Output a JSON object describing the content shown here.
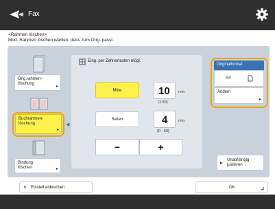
{
  "header": {
    "title": "Fax"
  },
  "message": {
    "line1": "<Rahmen löschen>",
    "line2": "Mod. Rahmen löschen wählen, dass zum Orig. passt."
  },
  "left": {
    "orig_frame": "Orig.rahmen-\nlöschung",
    "book_frame": "Buchrahmen-\nlöschung",
    "binding": "Bindung\nlöschen"
  },
  "center": {
    "note": "Eing. per Zehnertasten mögl.",
    "center_label": "Mitte",
    "center_value": "10",
    "center_unit": "mm",
    "center_range": "(1-50)",
    "side_label": "Seiten",
    "side_value": "4",
    "side_unit": "mm",
    "side_range": "(0 - 50)",
    "minus": "−",
    "plus": "+"
  },
  "right": {
    "format_header": "Originalformat",
    "format_value": "A4",
    "change": "Ändern",
    "independent": "Unabhängig\njustieren"
  },
  "bottom": {
    "cancel": "Einstell.abbrechen",
    "ok": "OK"
  }
}
